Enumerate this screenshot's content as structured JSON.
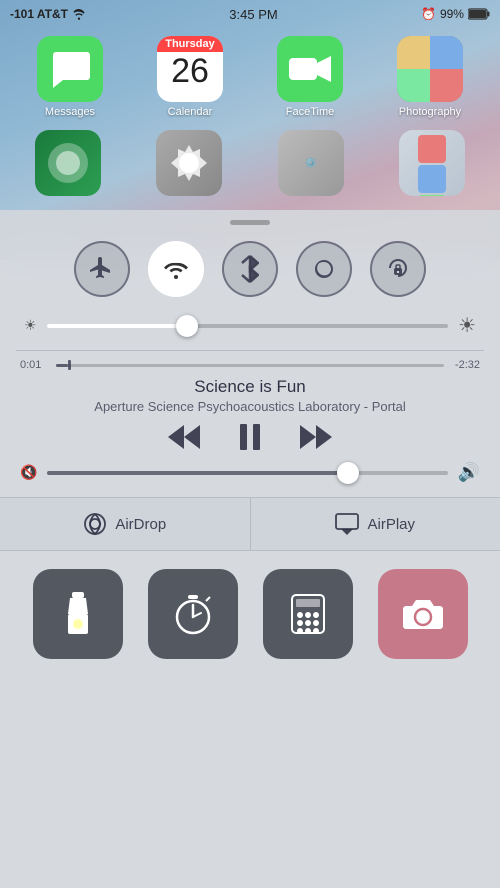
{
  "statusBar": {
    "carrier": "-101 AT&T",
    "time": "3:45 PM",
    "battery": "99%"
  },
  "apps": [
    {
      "id": "messages",
      "label": "Messages"
    },
    {
      "id": "calendar",
      "label": "Calendar",
      "day": "Thursday",
      "date": "26"
    },
    {
      "id": "facetime",
      "label": "FaceTime"
    },
    {
      "id": "photography",
      "label": "Photography"
    }
  ],
  "controlCenter": {
    "toggles": [
      {
        "id": "airplane",
        "label": "Airplane Mode",
        "active": false
      },
      {
        "id": "wifi",
        "label": "Wi-Fi",
        "active": true
      },
      {
        "id": "bluetooth",
        "label": "Bluetooth",
        "active": false
      },
      {
        "id": "donotdisturb",
        "label": "Do Not Disturb",
        "active": false
      },
      {
        "id": "rotation",
        "label": "Rotation Lock",
        "active": false
      }
    ],
    "brightness": {
      "value": 35,
      "label": "Brightness"
    },
    "music": {
      "currentTime": "0:01",
      "remainingTime": "-2:32",
      "songTitle": "Science is Fun",
      "artist": "Aperture Science Psychoacoustics Laboratory - Portal",
      "progress": 3,
      "volume": 75
    },
    "airdrop": {
      "label": "AirDrop"
    },
    "airplay": {
      "label": "AirPlay"
    },
    "quickAccess": [
      {
        "id": "flashlight",
        "label": "Flashlight"
      },
      {
        "id": "timer",
        "label": "Timer"
      },
      {
        "id": "calculator",
        "label": "Calculator"
      },
      {
        "id": "camera",
        "label": "Camera"
      }
    ]
  }
}
